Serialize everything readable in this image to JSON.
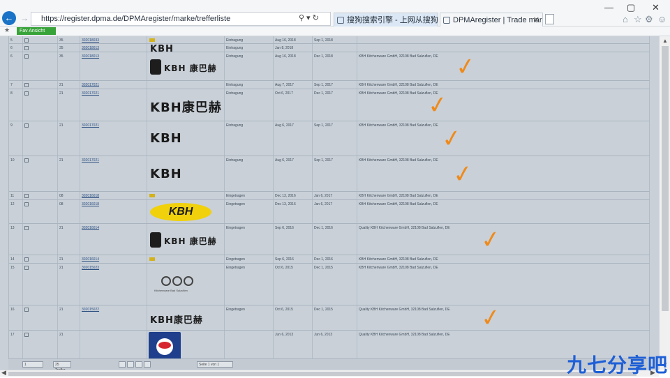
{
  "browser": {
    "url": "https://register.dpma.de/DPMAregister/marke/trefferliste",
    "tabs": [
      {
        "label": "搜狗搜索引擎 - 上网从搜狗开始"
      },
      {
        "label": "DPMAregister | Trade mar..."
      }
    ],
    "favorite_item": "Fav Ansicht",
    "window_controls": [
      "—",
      "▢",
      "✕"
    ],
    "accent": "#1a73c6"
  },
  "table": {
    "rows": [
      {
        "num": "5",
        "cls": "35",
        "link": "302018033",
        "logo": "small-mark",
        "status": "Eintragung",
        "d1": "Aug 16, 2018",
        "d2": "Sep 1, 2018",
        "desc": "",
        "checked": false
      },
      {
        "num": "6",
        "cls": "35",
        "link": "302018013",
        "logo": "text:KBH",
        "status": "Eintragung",
        "d1": "Jan 8, 2018",
        "d2": "",
        "desc": "",
        "checked": false
      },
      {
        "num": "6",
        "cls": "35",
        "link": "302018013",
        "logo": "tile:KBH 康巴赫",
        "status": "Eintragung",
        "d1": "Aug 16, 2018",
        "d2": "Dec 1, 2018",
        "desc": "KBH Kitchenware GmbH, 32108 Bad Salzuflen, DE",
        "checked": true
      },
      {
        "num": "7",
        "cls": "21",
        "link": "302017021",
        "logo": "",
        "status": "Eintragung",
        "d1": "Aug 7, 2017",
        "d2": "Sep 1, 2017",
        "desc": "KBH Kitchenware GmbH, 32108 Bad Salzuflen, DE",
        "checked": false
      },
      {
        "num": "8",
        "cls": "21",
        "link": "302017021",
        "logo": "text:KBH康巴赫",
        "status": "Eintragung",
        "d1": "Oct 6, 2017",
        "d2": "Dec 1, 2017",
        "desc": "KBH Kitchenware GmbH, 32108 Bad Salzuflen, DE",
        "checked": true
      },
      {
        "num": "9",
        "cls": "21",
        "link": "302017021",
        "logo": "text:KBH",
        "status": "Eintragung",
        "d1": "Aug 6, 2017",
        "d2": "Sep 1, 2017",
        "desc": "KBH Kitchenware GmbH, 32108 Bad Salzuflen, DE",
        "checked": true
      },
      {
        "num": "10",
        "cls": "21",
        "link": "302017021",
        "logo": "text:KBH",
        "status": "Eintragung",
        "d1": "Aug 6, 2017",
        "d2": "Sep 1, 2017",
        "desc": "KBH Kitchenware GmbH, 32108 Bad Salzuflen, DE",
        "checked": true
      },
      {
        "num": "11",
        "cls": "08",
        "link": "302016018",
        "logo": "small-mark",
        "status": "Eingetragen",
        "d1": "Dec 13, 2016",
        "d2": "Jan 6, 2017",
        "desc": "KBH Kitchenware GmbH, 32108 Bad Salzuflen, DE",
        "checked": false
      },
      {
        "num": "12",
        "cls": "08",
        "link": "302016018",
        "logo": "oval:KBH",
        "status": "Eingetragen",
        "d1": "Dec 13, 2016",
        "d2": "Jan 6, 2017",
        "desc": "KBH Kitchenware GmbH, 32108 Bad Salzuflen, DE",
        "checked": false
      },
      {
        "num": "13",
        "cls": "21",
        "link": "302016014",
        "logo": "tile:KBH 康巴赫",
        "status": "Eingetragen",
        "d1": "Sep 6, 2016",
        "d2": "Dec 1, 2016",
        "desc": "Quality KBH Kitchenware GmbH, 32108 Bad Salzuflen, DE",
        "checked": true
      },
      {
        "num": "14",
        "cls": "21",
        "link": "302016014",
        "logo": "small-mark",
        "status": "Eingetragen",
        "d1": "Sep 6, 2016",
        "d2": "Dec 1, 2016",
        "desc": "KBH Kitchenware GmbH, 32108 Bad Salzuflen, DE",
        "checked": false
      },
      {
        "num": "15",
        "cls": "21",
        "link": "302015023",
        "logo": "circles",
        "status": "Eingetragen",
        "d1": "Oct 6, 2015",
        "d2": "Dec 1, 2015",
        "desc": "KBH Kitchenware GmbH, 32108 Bad Salzuflen, DE",
        "checked": false
      },
      {
        "num": "16",
        "cls": "21",
        "link": "302015022",
        "logo": "text:KBH康巴赫",
        "status": "Eingetragen",
        "d1": "Oct 6, 2015",
        "d2": "Dec 1, 2015",
        "desc": "Quality KBH Kitchenware GmbH, 32108 Bad Salzuflen, DE",
        "checked": true
      },
      {
        "num": "17",
        "cls": "21",
        "link": "",
        "logo": "blue",
        "status": "",
        "d1": "Jun 6, 2013",
        "d2": "Jun 6, 2013",
        "desc": "Quality KBH Kitchenware GmbH, 32108 Bad Salzuflen, DE",
        "checked": false
      }
    ],
    "circles_caption": "Kitchenware Bad Salzuflen",
    "check_color": "#ef8a1a"
  },
  "pager": {
    "page_label": "1",
    "per_page": "25 Treffer",
    "summary": "Seite 1 von 1"
  },
  "watermark": "九七分享吧"
}
